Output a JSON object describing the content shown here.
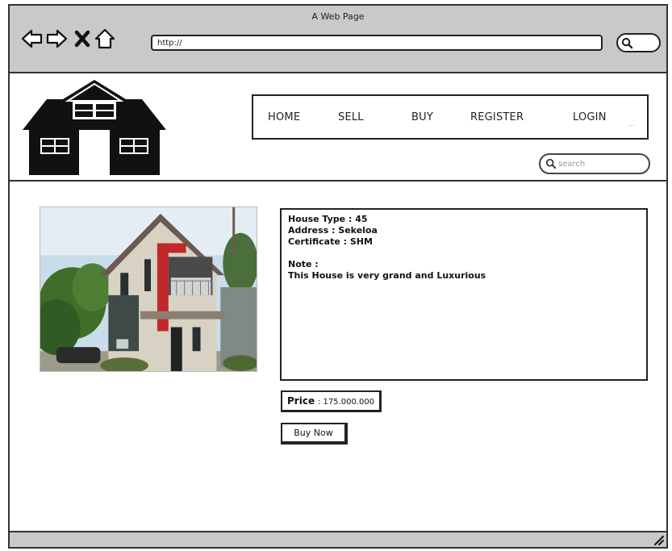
{
  "window": {
    "title": "A Web Page",
    "url": "http://"
  },
  "nav": {
    "items": [
      {
        "label": "HOME"
      },
      {
        "label": "SELL"
      },
      {
        "label": "BUY"
      },
      {
        "label": "REGISTER"
      },
      {
        "label": "LOGIN"
      }
    ],
    "more": "..."
  },
  "search": {
    "placeholder": "search"
  },
  "listing": {
    "house_type": "House Type : 45",
    "address": "Address : Sekeloa",
    "certificate": "Certificate : SHM",
    "note_label": "Note :",
    "note_text": "This House is very grand and Luxurious",
    "price_label": "Price",
    "price_value": ": 175.000.000",
    "buy_label": "Buy Now"
  },
  "icons": {
    "back": "back-arrow-icon",
    "forward": "forward-arrow-icon",
    "stop": "close-icon",
    "home": "home-icon",
    "search": "search-icon",
    "logo": "house-logo-icon"
  }
}
